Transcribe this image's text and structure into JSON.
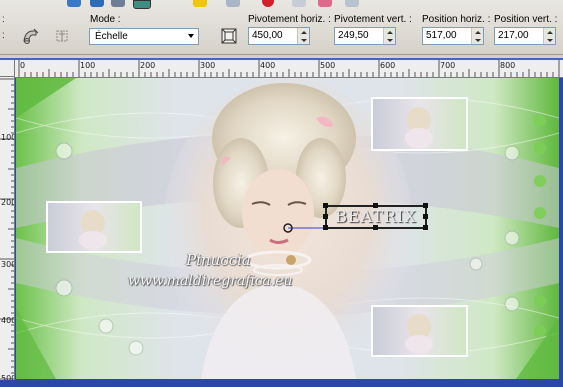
{
  "toolbar": {
    "mode_label": "Mode :",
    "mode_value": "Échelle",
    "pivot_h_label": "Pivotement horiz. :",
    "pivot_h_value": "450,00",
    "pivot_v_label": "Pivotement vert. :",
    "pivot_v_value": "249,50",
    "pos_h_label": "Position horiz. :",
    "pos_h_value": "517,00",
    "pos_v_label": "Position vert. :",
    "pos_v_value": "217,00"
  },
  "ruler": {
    "horizontal": [
      "0",
      "100",
      "200",
      "300",
      "400",
      "500",
      "600",
      "700",
      "800"
    ],
    "vertical": [
      "100",
      "200",
      "300",
      "400",
      "500"
    ]
  },
  "canvas": {
    "watermark_name": "Pinuccia",
    "watermark_url": "www.maldiregrafica.eu",
    "selected_text": "BEATRIX",
    "accent_green": "#6cc24a",
    "selection_frame": "#1a1a1a"
  },
  "icons": {
    "deform": "deform-tool-icon",
    "reset": "reset-icon",
    "mesh": "mesh-tool-icon"
  }
}
